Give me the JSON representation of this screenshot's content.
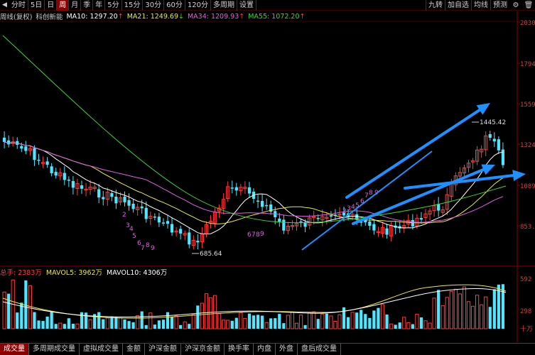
{
  "toolbar": {
    "items": [
      "分时",
      "5日",
      "日",
      "周",
      "月",
      "季",
      "年",
      "5分",
      "15分",
      "30分",
      "60分",
      "120分",
      "多周期",
      "设置"
    ],
    "active_index": 3,
    "right_items": [
      "九转",
      "加自选",
      "均线",
      "预测"
    ]
  },
  "ma_legend": {
    "title": "周线(复权)",
    "stock_name": "科创新能",
    "ma10": "MA10: 1297.20",
    "ma10_arrow": "↑",
    "ma21": "MA21: 1249.69",
    "ma21_arrow": "↓",
    "ma34": "MA34: 1209.93",
    "ma34_arrow": "↑",
    "ma55": "MA55: 1072.20",
    "ma55_arrow": "↑"
  },
  "price_axis": [
    "2030.5",
    "1794",
    "1559",
    "1324",
    "1089",
    "853."
  ],
  "price_annotations": {
    "high": "1445.42",
    "low": "685.64"
  },
  "nine_turn_labels": {
    "down1": [
      "2",
      "3",
      "4",
      "5",
      "6",
      "7",
      "8",
      "9"
    ],
    "down2": [
      "6",
      "7",
      "8",
      "9"
    ],
    "up": [
      "2",
      "3",
      "4",
      "5",
      "6",
      "7",
      "8",
      "9"
    ]
  },
  "volume_legend": {
    "total": "总手: 2383万",
    "mavol5": "MAVOL5: 3962万",
    "mavol10": "MAVOL10: 4306万"
  },
  "volume_axis": [
    "592",
    "298",
    "十万"
  ],
  "bottom_tabs": [
    "成交量",
    "多周期成交量",
    "虚拟成交量",
    "金额",
    "沪深金额",
    "沪深京金额",
    "换手率",
    "内盘",
    "外盘",
    "盘后成交量"
  ],
  "bottom_active_index": 0,
  "colors": {
    "up": "#ff3c3c",
    "down": "#4fe6ff",
    "ma10": "#ffffff",
    "ma21": "#e8e84a",
    "ma34": "#e060e0",
    "ma55": "#38d838",
    "arrow": "#1e90ff"
  }
}
